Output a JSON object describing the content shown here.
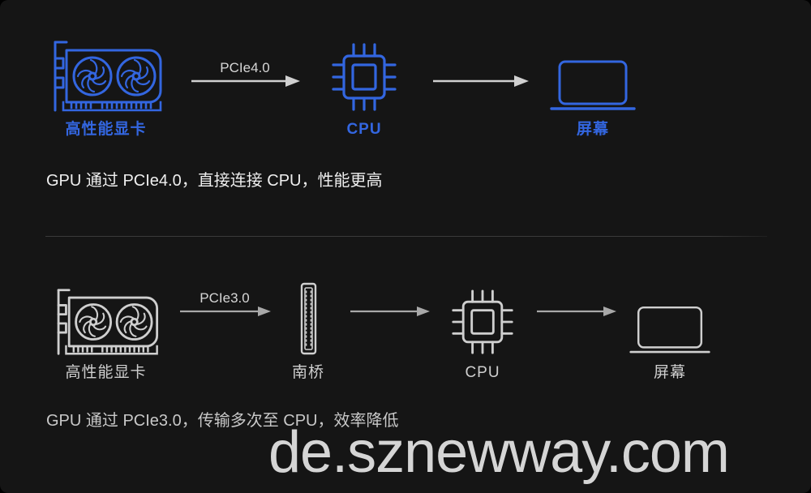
{
  "theme": {
    "background": "#151515",
    "accent_blue": "#3366e0",
    "muted_grey": "#cfcfcf",
    "caption_bright": "#efefef",
    "caption_dim": "#c8c8c8",
    "watermark_color": "#d5d5d5",
    "divider_color": "#3a3a3a"
  },
  "diagram": {
    "rows": [
      {
        "id": "pcie4-direct",
        "style": "accent",
        "nodes": [
          {
            "icon": "graphics-card-icon",
            "label": "高性能显卡"
          },
          {
            "icon": "cpu-chip-icon",
            "label": "CPU"
          },
          {
            "icon": "laptop-screen-icon",
            "label": "屏幕"
          }
        ],
        "arrows": [
          {
            "label": "PCIe4.0"
          },
          {
            "label": ""
          }
        ],
        "caption": "GPU 通过 PCIe4.0，直接连接 CPU，性能更高"
      },
      {
        "id": "pcie3-southbridge",
        "style": "muted",
        "nodes": [
          {
            "icon": "graphics-card-icon",
            "label": "高性能显卡"
          },
          {
            "icon": "southbridge-slot-icon",
            "label": "南桥"
          },
          {
            "icon": "cpu-chip-icon",
            "label": "CPU"
          },
          {
            "icon": "laptop-screen-icon",
            "label": "屏幕"
          }
        ],
        "arrows": [
          {
            "label": "PCIe3.0"
          },
          {
            "label": ""
          },
          {
            "label": ""
          }
        ],
        "caption": "GPU 通过 PCIe3.0，传输多次至 CPU，效率降低"
      }
    ]
  },
  "watermark": {
    "text": "de.sznewway.com"
  }
}
